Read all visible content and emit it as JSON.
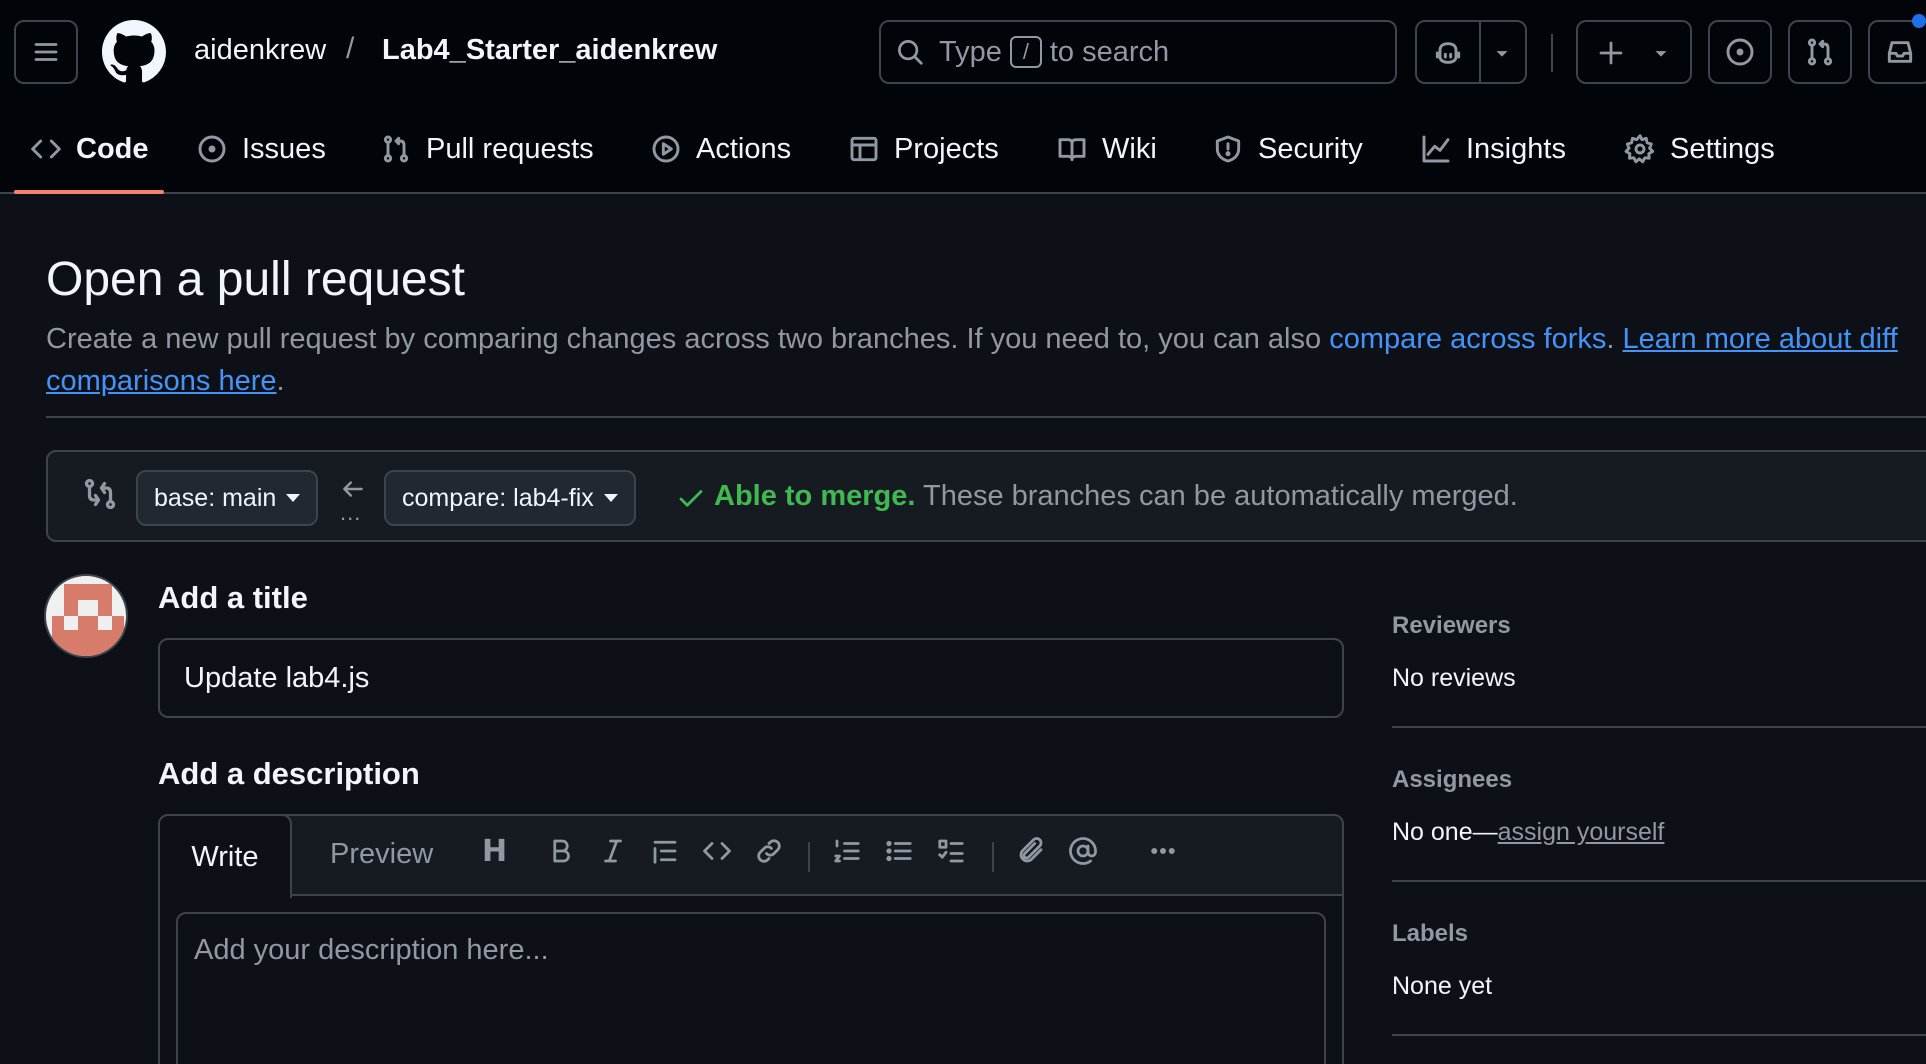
{
  "header": {
    "owner": "aidenkrew",
    "separator": "/",
    "repo": "Lab4_Starter_aidenkrew",
    "search": {
      "prefix": "Type",
      "key": "/",
      "suffix": "to search"
    }
  },
  "repo_nav": {
    "tabs": [
      {
        "label": "Code",
        "icon": "code-icon",
        "active": true
      },
      {
        "label": "Issues",
        "icon": "issue-opened-icon"
      },
      {
        "label": "Pull requests",
        "icon": "git-pull-request-icon"
      },
      {
        "label": "Actions",
        "icon": "play-icon"
      },
      {
        "label": "Projects",
        "icon": "table-icon"
      },
      {
        "label": "Wiki",
        "icon": "book-icon"
      },
      {
        "label": "Security",
        "icon": "shield-icon"
      },
      {
        "label": "Insights",
        "icon": "graph-icon"
      },
      {
        "label": "Settings",
        "icon": "gear-icon"
      }
    ]
  },
  "page": {
    "title": "Open a pull request",
    "desc_text": "Create a new pull request by comparing changes across two branches. If you need to, you can also ",
    "desc_link_forks": "compare across forks",
    "desc_mid": ". ",
    "desc_link_learn": "Learn more about diff comparisons here",
    "desc_end": "."
  },
  "compare": {
    "base_label": "base: main",
    "compare_label": "compare: lab4-fix",
    "dots": "...",
    "merge_status": "Able to merge.",
    "merge_desc": "These branches can be automatically merged."
  },
  "form": {
    "title_heading": "Add a title",
    "title_value": "Update lab4.js",
    "desc_heading": "Add a description",
    "tab_write": "Write",
    "tab_preview": "Preview",
    "heading_tool": "H",
    "desc_placeholder": "Add your description here..."
  },
  "sidebar": {
    "reviewers_heading": "Reviewers",
    "reviewers_value": "No reviews",
    "assignees_heading": "Assignees",
    "assignees_prefix": "No one—",
    "assignees_link": "assign yourself",
    "labels_heading": "Labels",
    "labels_value": "None yet"
  },
  "colors": {
    "background": "#0d1117",
    "header": "#010409",
    "border": "#3d444d",
    "link": "#4493f8",
    "success": "#3fb950",
    "active_tab_underline": "#f78166",
    "muted_text": "#9198a1"
  }
}
